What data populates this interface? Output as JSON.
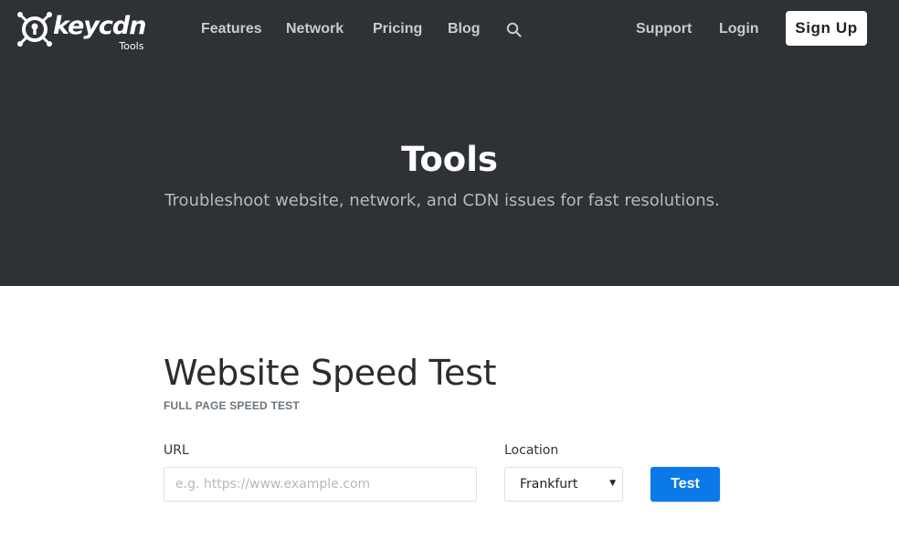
{
  "brand": {
    "name": "keycdn",
    "sub": "Tools",
    "icon": "keycdn-logo-icon"
  },
  "nav": {
    "items": [
      {
        "label": "Features"
      },
      {
        "label": "Network"
      },
      {
        "label": "Pricing"
      },
      {
        "label": "Blog"
      }
    ],
    "search_icon": "search-icon",
    "right_items": [
      {
        "label": "Support"
      },
      {
        "label": "Login"
      }
    ],
    "signup_label": "Sign Up"
  },
  "hero": {
    "title": "Tools",
    "subtitle": "Troubleshoot website, network, and CDN issues for fast resolutions."
  },
  "main": {
    "title": "Website Speed Test",
    "subtitle": "FULL PAGE SPEED TEST",
    "form": {
      "url_label": "URL",
      "url_placeholder": "e.g. https://www.example.com",
      "url_value": "",
      "location_label": "Location",
      "location_value": "Frankfurt",
      "test_label": "Test"
    }
  },
  "colors": {
    "hero_bg": "#2e3135",
    "accent": "#0b79e8",
    "nav_text": "#c9cbcd"
  }
}
